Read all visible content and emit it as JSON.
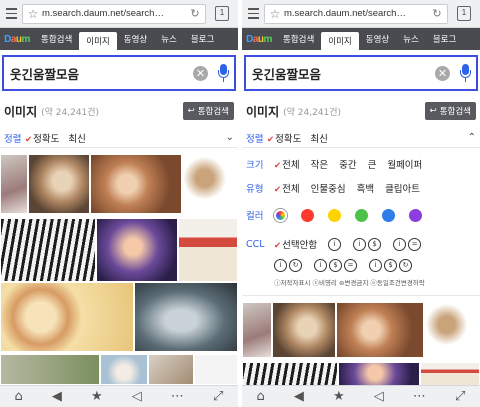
{
  "browser": {
    "url": "m.search.daum.net/search…",
    "tab_count": "1"
  },
  "nav": {
    "logo_letters": [
      "D",
      "a",
      "u",
      "m"
    ],
    "tabs": [
      "통합검색",
      "이미지",
      "동영상",
      "뉴스",
      "블로그"
    ],
    "active_tab": "이미지"
  },
  "search": {
    "query": "웃긴움짤모음",
    "clear_glyph": "✕"
  },
  "results": {
    "title": "이미지",
    "count": "(약 24,241건)",
    "integrated_button": "통합검색",
    "return_glyph": "↩"
  },
  "sort": {
    "label": "정렬",
    "options": [
      "정확도",
      "최신"
    ],
    "selected": "정확도",
    "left_chevron": "⌄",
    "right_chevron": "⌃"
  },
  "filters": {
    "size": {
      "label": "크기",
      "options": [
        "전체",
        "작은",
        "중간",
        "큰",
        "월페이퍼"
      ]
    },
    "type": {
      "label": "유형",
      "options": [
        "전체",
        "인물중심",
        "흑백",
        "클립아트"
      ]
    },
    "color": {
      "label": "컬러",
      "swatches": [
        "#ff3b30",
        "#ffd300",
        "#4cc24a",
        "#2f7de8",
        "#8a3ee0"
      ]
    },
    "ccl": {
      "label": "CCL",
      "first_option": "선택안함",
      "icons": [
        [
          "i"
        ],
        [
          "i",
          "$"
        ],
        [
          "i",
          "="
        ],
        [
          "i",
          "↻"
        ],
        [
          "i",
          "$",
          "="
        ],
        [
          "i",
          "$",
          "↻"
        ]
      ],
      "legend": "ⓘ저작자표시  ⓢ비영리  ⊜변경금지  ⓞ동일조건변경허락"
    }
  },
  "toolbar": {
    "icons": [
      "⌂",
      "◀",
      "★",
      "◁",
      "⋯",
      "⤢"
    ],
    "names": [
      "home-icon",
      "back-icon",
      "bookmark-icon",
      "share-icon",
      "more-icon",
      "fullscreen-icon"
    ]
  },
  "colors": {
    "accent_blue": "#2f64e8",
    "nav_bg": "#4a4b50",
    "check_red": "#e03b3b"
  }
}
